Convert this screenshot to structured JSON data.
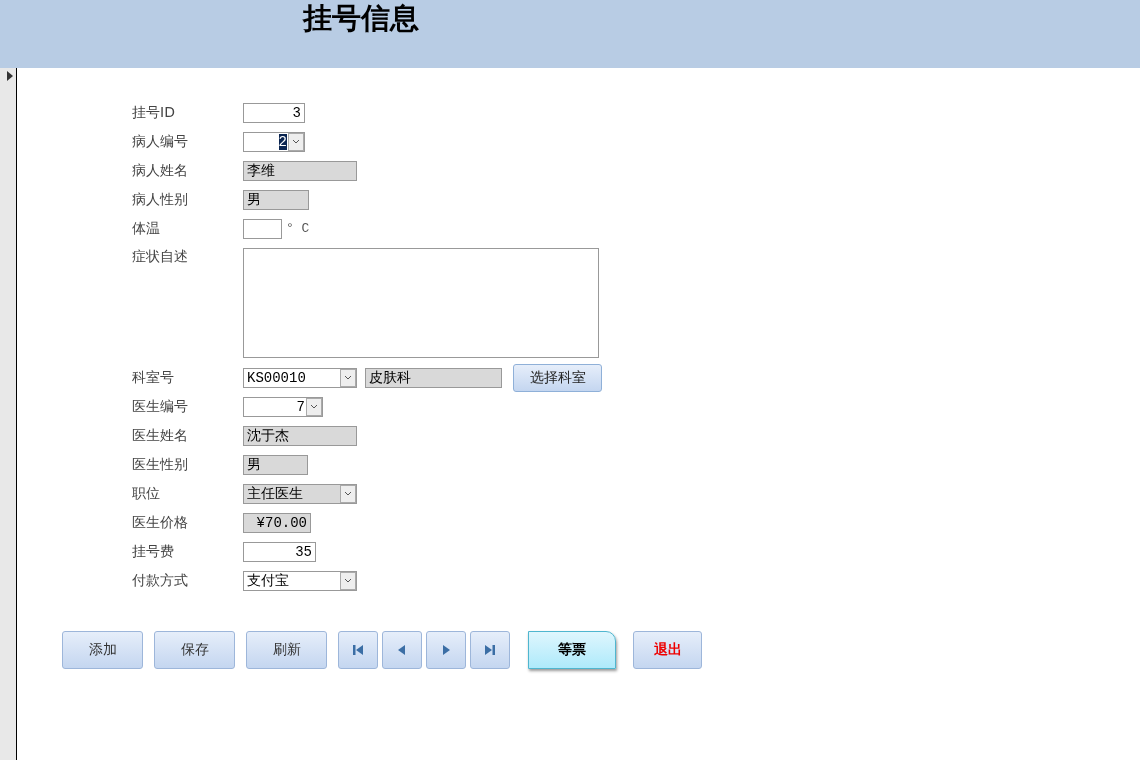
{
  "header": {
    "title": "挂号信息"
  },
  "record_selector": {
    "current": true
  },
  "fields": [
    {
      "label": "挂号ID",
      "controls": [
        {
          "kind": "number",
          "value": "3"
        }
      ]
    },
    {
      "label": "病人编号",
      "controls": [
        {
          "kind": "combonumber",
          "value": "2",
          "readonly": false,
          "focused": true
        }
      ]
    },
    {
      "label": "病人姓名",
      "controls": [
        {
          "kind": "readonly",
          "value": "李维"
        }
      ]
    },
    {
      "label": "病人性别",
      "controls": [
        {
          "kind": "readonly",
          "value": "男"
        }
      ]
    },
    {
      "label": "体温",
      "controls": [
        {
          "kind": "number"
        },
        {
          "kind": "unit",
          "value": "° C"
        }
      ]
    },
    {
      "label": "症状自述",
      "controls": [
        {
          "kind": "memo"
        }
      ]
    },
    {
      "label": "科室号",
      "controls": [
        {
          "kind": "combo",
          "value": "KS00010",
          "readonly": false,
          "focused": false
        },
        {
          "kind": "readonly",
          "value": "皮肤科"
        },
        {
          "kind": "button",
          "value": "选择科室"
        }
      ]
    },
    {
      "label": "医生编号",
      "controls": [
        {
          "kind": "combonumber",
          "value": "7",
          "readonly": false,
          "focused": false
        }
      ]
    },
    {
      "label": "医生姓名",
      "controls": [
        {
          "kind": "readonly",
          "value": "沈于杰"
        }
      ]
    },
    {
      "label": "医生性别",
      "controls": [
        {
          "kind": "readonly",
          "value": "男"
        }
      ]
    },
    {
      "label": "职位",
      "controls": [
        {
          "kind": "combo",
          "value": "主任医生",
          "readonly": true,
          "focused": false
        }
      ]
    },
    {
      "label": "医生价格",
      "controls": [
        {
          "kind": "readonlynumber",
          "value": "¥70.00"
        }
      ]
    },
    {
      "label": "挂号费",
      "controls": [
        {
          "kind": "number",
          "value": "35"
        }
      ]
    },
    {
      "label": "付款方式",
      "controls": [
        {
          "kind": "combo",
          "value": "支付宝",
          "readonly": false,
          "focused": false
        }
      ]
    }
  ],
  "buttons": [
    {
      "kind": "plain",
      "label": "添加"
    },
    {
      "kind": "plain",
      "label": "保存"
    },
    {
      "kind": "plain",
      "label": "刷新"
    },
    {
      "kind": "first"
    },
    {
      "kind": "prev"
    },
    {
      "kind": "next"
    },
    {
      "kind": "last"
    },
    {
      "kind": "accent",
      "label": "等票"
    },
    {
      "kind": "danger",
      "label": "退出"
    }
  ]
}
